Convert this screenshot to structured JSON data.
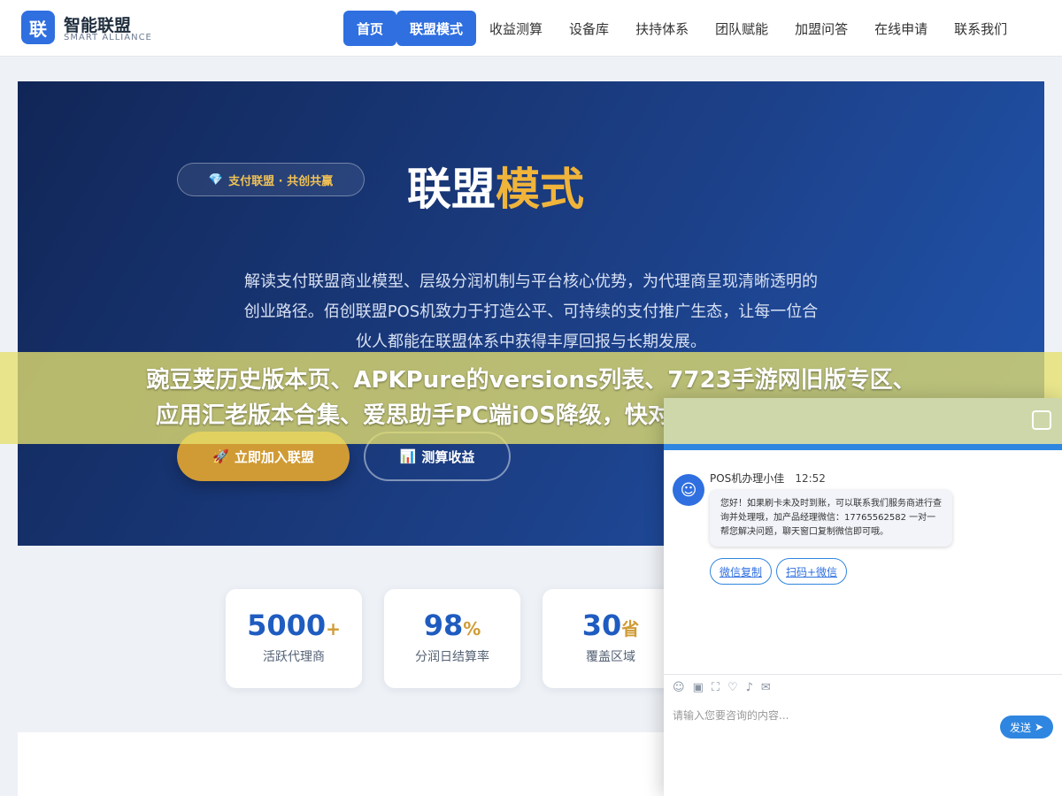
{
  "header": {
    "logo_char": "联",
    "logo_name": "智能联盟",
    "logo_sub": "SMART ALLIANCE",
    "nav": [
      "首页",
      "联盟模式",
      "收益测算",
      "设备库",
      "扶持体系",
      "团队赋能",
      "加盟问答",
      "在线申请",
      "联系我们"
    ]
  },
  "hero": {
    "badge_icon": "💎",
    "badge": "支付联盟 · 共创共赢",
    "title_white": "联盟",
    "title_gold": "模式",
    "desc": "解读支付联盟商业模型、层级分润机制与平台核心优势，为代理商呈现清晰透明的创业路径。佰创联盟POS机致力于打造公平、可持续的支付推广生态，让每一位合伙人都能在联盟体系中获得丰厚回报与长期发展。",
    "join_icon": "🚀",
    "join_label": "立即加入联盟",
    "calc_icon": "📊",
    "calc_label": "测算收益"
  },
  "overlay": {
    "line1": "豌豆荚历史版本页、APKPure的versions列表、7723手游网旧版专区、",
    "line2": "应用汇老版本合集、爱思助手PC端iOS降级，快对APP从最新版降回旧版"
  },
  "stats": [
    {
      "value": "5000",
      "unit": "+",
      "label": "活跃代理商"
    },
    {
      "value": "98",
      "unit": "%",
      "label": "分润日结算率"
    },
    {
      "value": "30",
      "unit": "省",
      "label": "覆盖区域"
    }
  ],
  "chat": {
    "avatar_icon": "☺",
    "sender": "POS机办理小佳",
    "time": "12:52",
    "message": "您好！如果刷卡未及时到账，可以联系我们服务商进行查询并处理哦，加产品经理微信：17765562582 一对一帮您解决问题，聊天窗口复制微信即可哦。",
    "chip1": "微信复制",
    "chip2": "扫码+微信",
    "tools": [
      "☺",
      "▣",
      "⛶",
      "♡",
      "♪",
      "✉"
    ],
    "input_placeholder": "请输入您要咨询的内容...",
    "send_label": "发送"
  }
}
